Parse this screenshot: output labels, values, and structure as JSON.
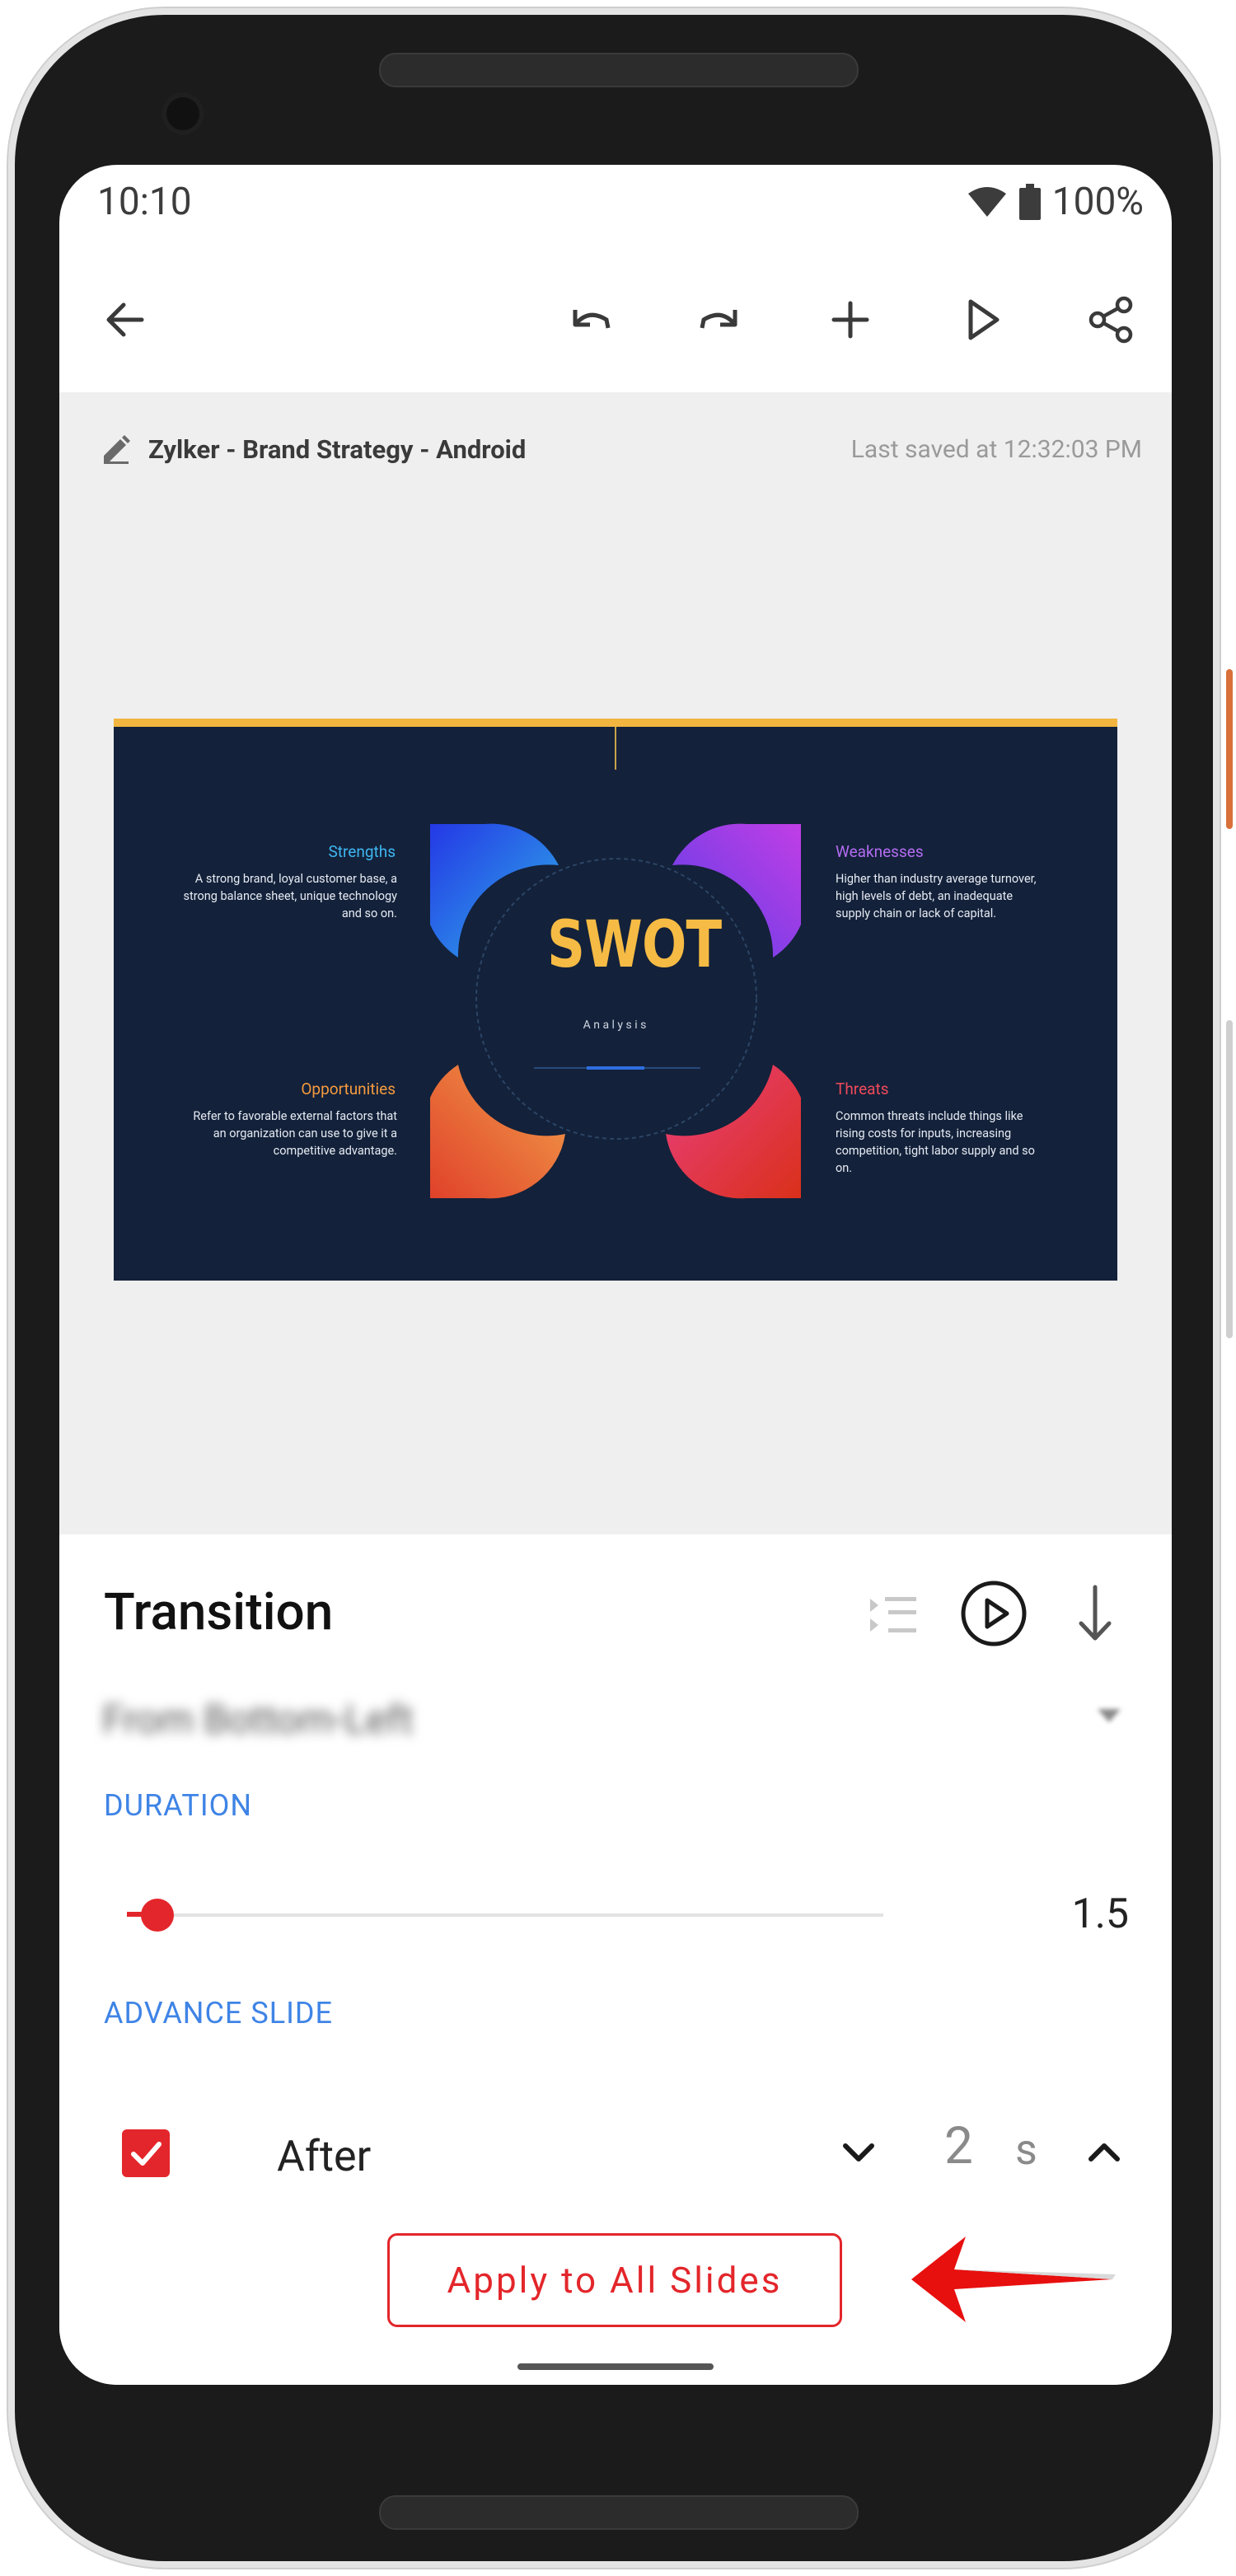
{
  "status_bar": {
    "time": "10:10",
    "battery": "100%"
  },
  "toolbar": {
    "icons": [
      "back-arrow-icon",
      "undo-icon",
      "redo-icon",
      "add-icon",
      "play-icon",
      "share-icon"
    ]
  },
  "document": {
    "title": "Zylker - Brand Strategy - Android",
    "last_saved": "Last saved at 12:32:03 PM"
  },
  "slide": {
    "heading": "SWOT",
    "subheading": "A n a l y s i s",
    "colors": {
      "background": "#13213a",
      "accent_bar": "#f2b540",
      "heading": "#f6bb44"
    },
    "quadrants": [
      {
        "title": "Strengths",
        "color": "#3fb6f0",
        "text": "A strong brand, loyal customer base, a strong balance sheet, unique technology and so on."
      },
      {
        "title": "Weaknesses",
        "color": "#b36cf0",
        "text": "Higher than industry average turnover, high levels of debt, an inadequate supply chain or lack of capital."
      },
      {
        "title": "Opportunities",
        "color": "#f49a3e",
        "text": "Refer to favorable external factors that an organization can use to give it a competitive advantage."
      },
      {
        "title": "Threats",
        "color": "#ef4a5a",
        "text": "Common threats include things like rising costs for inputs, increasing competition, tight labor supply and so on."
      }
    ]
  },
  "transition_panel": {
    "title": "Transition",
    "effect": "From Bottom-Left",
    "duration_label": "DURATION",
    "duration_value": "1.5",
    "duration_fraction": 0.04,
    "advance_label": "ADVANCE SLIDE",
    "after_label": "After",
    "after_checked": true,
    "after_value": "2",
    "after_unit": "s",
    "apply_button": "Apply to All Slides"
  },
  "accent_colors": {
    "primary_red": "#e3262b",
    "label_blue": "#3f84e6"
  }
}
